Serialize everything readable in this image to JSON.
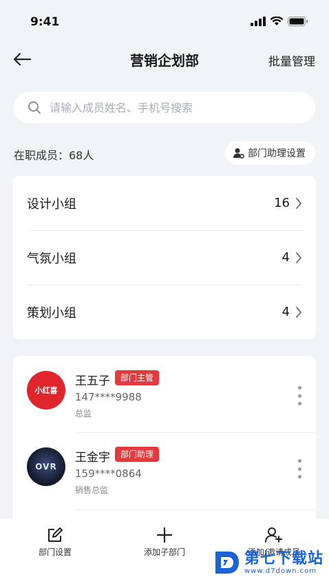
{
  "status_bar": {
    "time": "9:41"
  },
  "nav": {
    "title": "营销企划部",
    "action": "批量管理"
  },
  "search": {
    "placeholder": "请输入成员姓名、手机号搜索"
  },
  "summary": {
    "member_count": "在职成员：68人",
    "assistant_button": "部门助理设置"
  },
  "groups": [
    {
      "name": "设计小组",
      "count": "16"
    },
    {
      "name": "气氛小组",
      "count": "4"
    },
    {
      "name": "策划小组",
      "count": "4"
    }
  ],
  "members": [
    {
      "name": "王五子",
      "role": "部门主管",
      "phone": "147****9988",
      "title": "总监",
      "avatar_text": "小红喜"
    },
    {
      "name": "王金宇",
      "role": "部门助理",
      "phone": "159****0864",
      "title": "销售总监",
      "avatar_text": "OVR"
    }
  ],
  "bottom_bar": {
    "dept_settings": "部门设置",
    "add_sub_dept": "添加子部门",
    "add_invite": "添加/邀请成员"
  },
  "watermark": {
    "title": "第七下载站",
    "url": "www.d7down.com"
  },
  "colors": {
    "accent": "#e23a3e",
    "background": "#f2f3f6",
    "watermark": "#1c63d8"
  }
}
